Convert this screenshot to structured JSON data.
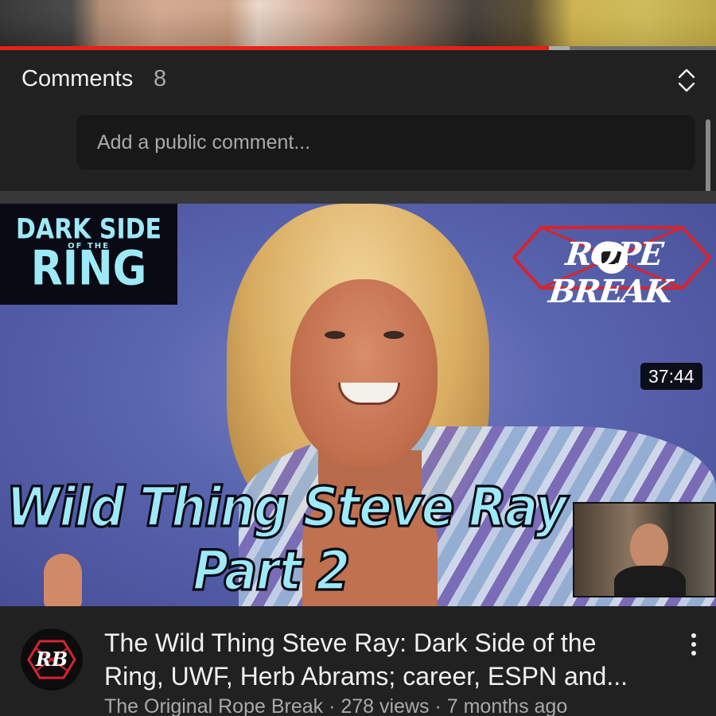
{
  "player": {
    "progress_fraction": 0.767,
    "buffer_fraction": 0.795
  },
  "comments": {
    "title": "Comments",
    "count": "8",
    "input_placeholder": "Add a public comment...",
    "expand_icon": "unfold-icon"
  },
  "video": {
    "thumbnail": {
      "logo_left_line1": "DARK SIDE",
      "logo_left_line2": "OF THE",
      "logo_left_line3": "RING",
      "logo_right": "ROPE BREAK",
      "caption_line1": "Wild Thing Steve Ray",
      "caption_line2": "Part 2"
    },
    "duration": "37:44",
    "title_line1": "The Wild Thing Steve Ray: Dark Side of the",
    "title_line2": "Ring, UWF, Herb Abrams; career, ESPN and...",
    "meta": "The Original Rope Break · 278 views · 7 months ago",
    "channel_avatar_text": "RB",
    "more_icon": "more-vert-icon"
  },
  "colors": {
    "background": "#212121",
    "progress": "#e62117",
    "accent_text": "#9ee9f7",
    "secondary_text": "#aaaaaa"
  }
}
